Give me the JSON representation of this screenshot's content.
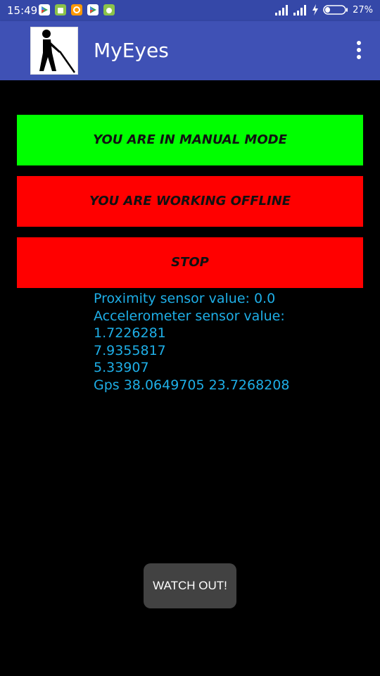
{
  "status_bar": {
    "time": "15:49",
    "battery_percent": "27%",
    "notification_icons": [
      "play-store-icon",
      "android-icon",
      "app-icon",
      "play-store-icon",
      "android-icon"
    ]
  },
  "app_bar": {
    "title": "MyEyes",
    "logo_icon": "blind-person-with-cane-icon",
    "menu_icon": "overflow-menu-icon"
  },
  "buttons": {
    "manual_mode": "YOU ARE IN MANUAL MODE",
    "offline": "YOU ARE WORKING OFFLINE",
    "stop": "STOP"
  },
  "sensors": {
    "proximity": "Proximity sensor value: 0.0",
    "accelerometer_label": "Accelerometer sensor value:",
    "accelerometer_values": [
      "1.7226281",
      "7.9355817",
      "5.33907"
    ],
    "gps": "Gps 38.0649705 23.7268208"
  },
  "toast": {
    "message": "WATCH OUT!"
  },
  "colors": {
    "status_bar": "#3548a8",
    "app_bar": "#3f51b5",
    "manual_mode_bg": "#00ff00",
    "offline_bg": "#ff0000",
    "stop_bg": "#ff0000",
    "sensor_text": "#1eaee6",
    "toast_bg": "#424242",
    "background": "#000000"
  }
}
